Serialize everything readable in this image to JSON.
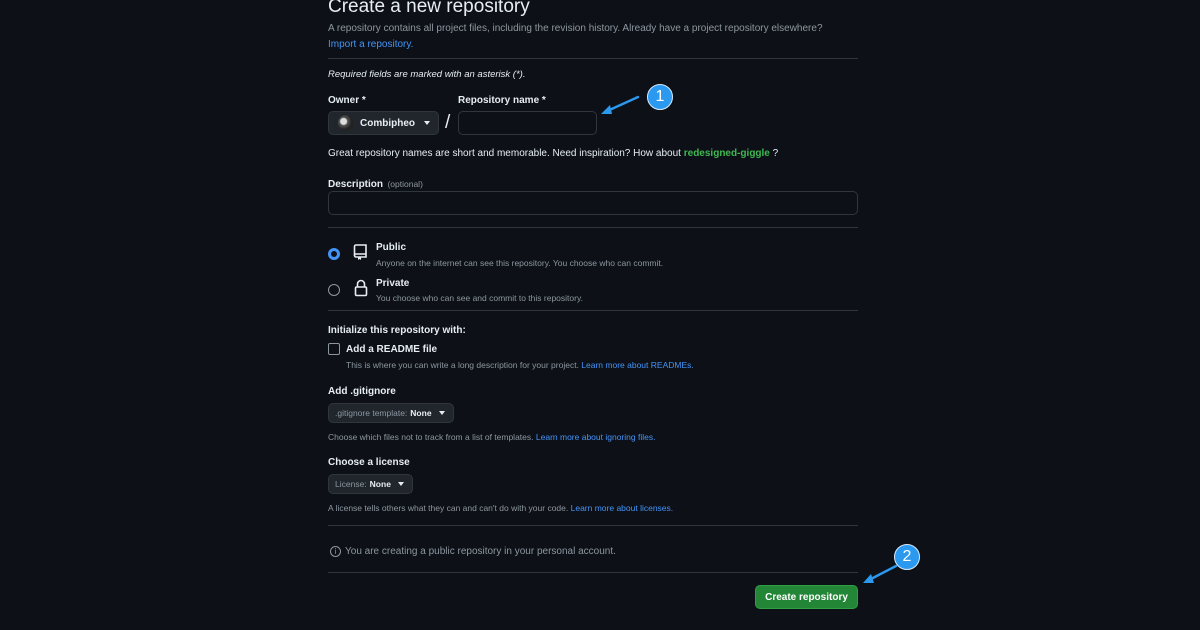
{
  "header": {
    "title": "Create a new repository",
    "description": "A repository contains all project files, including the revision history. Already have a project repository elsewhere?",
    "import_link": "Import a repository."
  },
  "required_note": "Required fields are marked with an asterisk (*).",
  "owner": {
    "label": "Owner *",
    "value": "Combipheo"
  },
  "repo_name": {
    "label": "Repository name *",
    "value": ""
  },
  "name_hint": {
    "text": "Great repository names are short and memorable. Need inspiration? How about",
    "suggestion": "redesigned-giggle",
    "suffix": "?"
  },
  "description_field": {
    "label": "Description",
    "optional": "(optional)",
    "value": ""
  },
  "visibility": {
    "selected": "public",
    "public": {
      "label": "Public",
      "desc": "Anyone on the internet can see this repository. You choose who can commit."
    },
    "private": {
      "label": "Private",
      "desc": "You choose who can see and commit to this repository."
    }
  },
  "initialize": {
    "heading": "Initialize this repository with:",
    "readme_label": "Add a README file",
    "readme_checked": false,
    "readme_desc": "This is where you can write a long description for your project.",
    "readme_link": "Learn more about READMEs."
  },
  "gitignore": {
    "heading": "Add .gitignore",
    "prefix": ".gitignore template:",
    "value": "None",
    "desc": "Choose which files not to track from a list of templates.",
    "link": "Learn more about ignoring files."
  },
  "license": {
    "heading": "Choose a license",
    "prefix": "License:",
    "value": "None",
    "desc": "A license tells others what they can and can't do with your code.",
    "link": "Learn more about licenses."
  },
  "info_message": "You are creating a public repository in your personal account.",
  "create_button": "Create repository",
  "annotations": {
    "badge1": "1",
    "badge2": "2",
    "color": "#2b99f0"
  },
  "colors": {
    "accent": "#4493f8",
    "primary_button": "#238636",
    "background": "#0d1117",
    "suggestion": "#3fb950"
  }
}
